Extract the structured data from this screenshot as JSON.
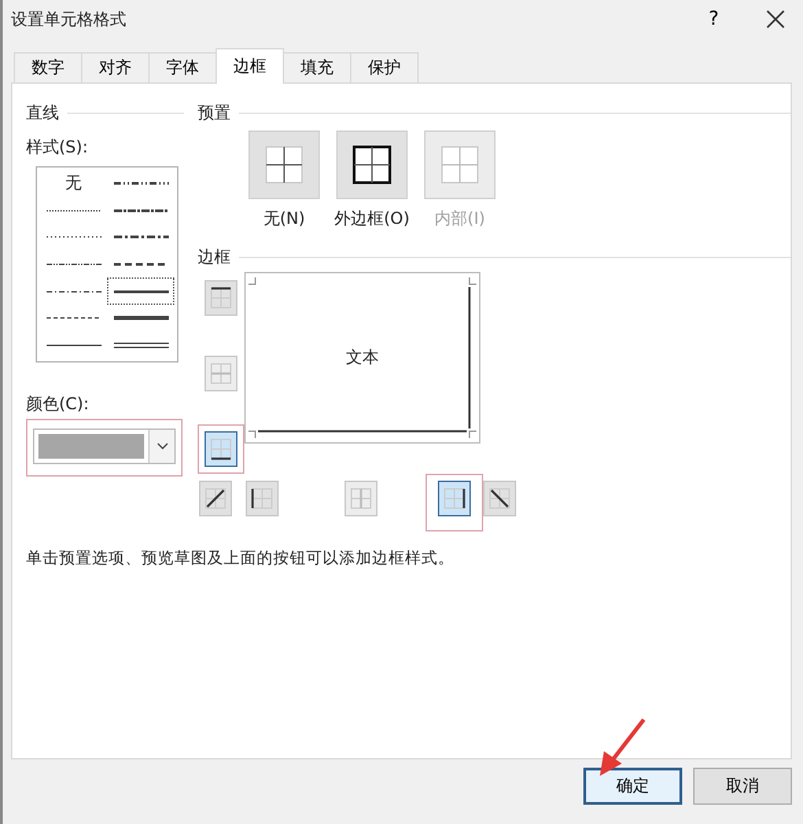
{
  "window": {
    "title": "设置单元格格式",
    "help": "?"
  },
  "tabs": [
    {
      "label": "数字",
      "selected": false
    },
    {
      "label": "对齐",
      "selected": false
    },
    {
      "label": "字体",
      "selected": false
    },
    {
      "label": "边框",
      "selected": true
    },
    {
      "label": "填充",
      "selected": false
    },
    {
      "label": "保护",
      "selected": false
    }
  ],
  "line": {
    "title": "直线",
    "style_label": "样式(S):",
    "styles": [
      {
        "kind": "none",
        "label": "无",
        "selected": false
      },
      {
        "kind": "hair",
        "selected": false
      },
      {
        "kind": "dotted",
        "selected": false
      },
      {
        "kind": "dashdotdot",
        "selected": false
      },
      {
        "kind": "dashdot",
        "selected": false
      },
      {
        "kind": "dashed",
        "selected": false
      },
      {
        "kind": "thin",
        "selected": false
      },
      {
        "kind": "mediumdashdotdot",
        "selected": false
      },
      {
        "kind": "slantdashdot",
        "selected": false
      },
      {
        "kind": "mediumdashdot",
        "selected": false
      },
      {
        "kind": "mediumdashed",
        "selected": false
      },
      {
        "kind": "medium",
        "selected": true
      },
      {
        "kind": "thick",
        "selected": false
      },
      {
        "kind": "double",
        "selected": false
      }
    ],
    "color_label": "颜色(C):",
    "color": "#a6a6a6",
    "color_highlighted": true
  },
  "presets": {
    "title": "预置",
    "items": [
      {
        "kind": "none",
        "label": "无(N)",
        "disabled": false
      },
      {
        "kind": "outline",
        "label": "外边框(O)",
        "disabled": false
      },
      {
        "kind": "inside",
        "label": "内部(I)",
        "disabled": true
      }
    ]
  },
  "border": {
    "title": "边框",
    "preview_text": "文本",
    "side_buttons": [
      {
        "kind": "top",
        "selected": false,
        "disabled": false,
        "highlighted": false
      },
      {
        "kind": "middle-h",
        "selected": false,
        "disabled": true,
        "highlighted": false
      },
      {
        "kind": "bottom",
        "selected": true,
        "disabled": false,
        "highlighted": true
      }
    ],
    "bottom_buttons": [
      {
        "kind": "diag-up",
        "selected": false,
        "disabled": false,
        "highlighted": false
      },
      {
        "kind": "left",
        "selected": false,
        "disabled": false,
        "highlighted": false
      },
      {
        "kind": "middle-v",
        "selected": false,
        "disabled": true,
        "highlighted": false
      },
      {
        "kind": "right",
        "selected": true,
        "disabled": false,
        "highlighted": true
      },
      {
        "kind": "diag-down",
        "selected": false,
        "disabled": false,
        "highlighted": false
      }
    ]
  },
  "hint": "单击预置选项、预览草图及上面的按钮可以添加边框样式。",
  "buttons": [
    {
      "label": "确定",
      "default": true,
      "arrow": true
    },
    {
      "label": "取消",
      "default": false,
      "arrow": false
    }
  ]
}
